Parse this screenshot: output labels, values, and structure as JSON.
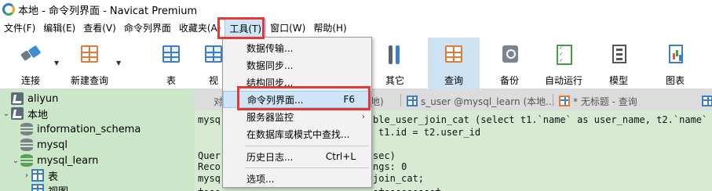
{
  "window": {
    "title": "本地 - 命令列界面 - Navicat Premium"
  },
  "menubar": {
    "items": [
      "文件(F)",
      "编辑(E)",
      "查看(V)",
      "命令列界面",
      "收藏夹(A)",
      "工具(T)",
      "窗口(W)",
      "帮助(H)"
    ]
  },
  "toolbar": {
    "connect": "连接",
    "new_query": "新建查询",
    "table": "表",
    "view_partial": "视",
    "other": "其它",
    "query": "查询",
    "backup": "备份",
    "autorun": "自动运行",
    "model": "模型",
    "chart": "图表"
  },
  "tree": {
    "items": [
      {
        "label": "aliyun"
      },
      {
        "label": "本地"
      },
      {
        "label": "information_schema"
      },
      {
        "label": "mysql"
      },
      {
        "label": "mysql_learn"
      },
      {
        "label": "表"
      },
      {
        "label": "视图"
      }
    ]
  },
  "tabs": {
    "t1": "对",
    "t2": "地)",
    "t3": "s_user @mysql_learn (本地...",
    "t4": "* 无标题 - 查询"
  },
  "console": {
    "lines": [
      "mysq",
      "",
      "Quer",
      "Reco",
      "mysq",
      "+---"
    ],
    "right_lines": [
      "ble_user_join_cat (select t1.`name` as user_name, t2.`name` as",
      "t1.id = t2.user_id",
      "sec)",
      "ngs: 0",
      "join_cat;",
      "-+---------+"
    ]
  },
  "dropdown": {
    "items": [
      {
        "label": "数据传输..."
      },
      {
        "label": "数据同步..."
      },
      {
        "label": "结构同步..."
      },
      {
        "label": "命令列界面...",
        "shortcut": "F6"
      },
      {
        "label": "服务器监控"
      },
      {
        "label": "在数据库或模式中查找..."
      },
      {
        "label": "历史日志...",
        "shortcut": "Ctrl+L"
      },
      {
        "label": "选项..."
      }
    ]
  },
  "colors": {
    "highlight_border": "#e53935",
    "tree_bg": "#cbe6c8",
    "console_bg": "#d6ebd2",
    "menu_hover": "#cfe4f6"
  }
}
